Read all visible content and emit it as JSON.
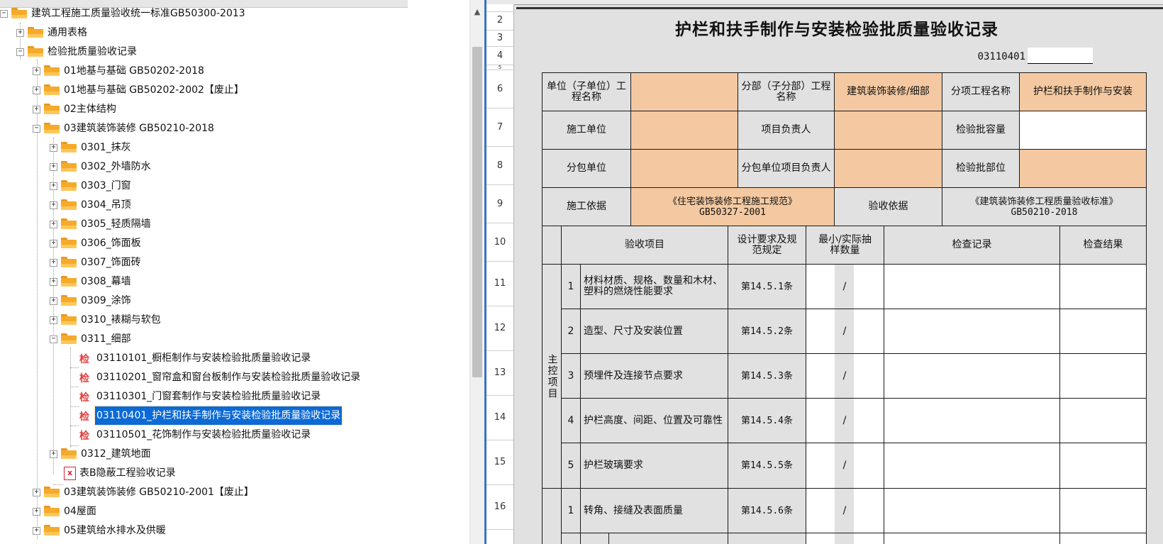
{
  "tree": {
    "root": "建筑工程施工质量验收统一标准GB50300-2013",
    "general": "通用表格",
    "inspection": "检验批质量验收记录",
    "cat01a": "01地基与基础 GB50202-2018",
    "cat01b": "01地基与基础 GB50202-2002【废止】",
    "cat02": "02主体结构",
    "cat03": "03建筑装饰装修 GB50210-2018",
    "sub": [
      "0301_抹灰",
      "0302_外墙防水",
      "0303_门窗",
      "0304_吊顶",
      "0305_轻质隔墙",
      "0306_饰面板",
      "0307_饰面砖",
      "0308_幕墙",
      "0309_涂饰",
      "0310_裱糊与软包",
      "0311_细部"
    ],
    "leaf_icon": "检",
    "leaves": [
      "03110101_橱柜制作与安装检验批质量验收记录",
      "03110201_窗帘盒和窗台板制作与安装检验批质量验收记录",
      "03110301_门窗套制作与安装检验批质量验收记录",
      "03110401_护栏和扶手制作与安装检验批质量验收记录",
      "03110501_花饰制作与安装检验批质量验收记录"
    ],
    "cat0312": "0312_建筑地面",
    "hidden_record": "表B隐蔽工程验收记录",
    "cat03old": "03建筑装饰装修 GB50210-2001【废止】",
    "cat04": "04屋面",
    "cat05": "05建筑给水排水及供暖",
    "expand_plus": "+",
    "expand_minus": "−",
    "scroll_up": "▲"
  },
  "sheet": {
    "rows": [
      "",
      "2",
      "3",
      "4",
      "5",
      "6",
      "7",
      "8",
      "9",
      "10",
      "11",
      "12",
      "13",
      "14",
      "15",
      "16"
    ],
    "title": "护栏和扶手制作与安装检验批质量验收记录",
    "code": "03110401",
    "unit_name_label": "单位（子单位）工程名称",
    "division_label": "分部（子分部）工程名称",
    "division_value": "建筑装饰装修/细部",
    "subitem_label": "分项工程名称",
    "subitem_value": "护栏和扶手制作与安装",
    "constructor_label": "施工单位",
    "pm_label": "项目负责人",
    "capacity_label": "检验批容量",
    "subcontractor_label": "分包单位",
    "sub_pm_label": "分包单位项目负责人",
    "location_label": "检验批部位",
    "basis_label": "施工依据",
    "basis_value": "《住宅装饰装修工程施工规范》GB50327-2001",
    "accept_basis_label": "验收依据",
    "accept_basis_value": "《建筑装饰装修工程质量验收标准》GB50210-2018",
    "h_item": "验收项目",
    "h_design": "设计要求及规范规定",
    "h_sample": "最小/实际抽样数量",
    "h_record": "检查记录",
    "h_result": "检查结果",
    "main_label": "主控项目",
    "items": [
      {
        "no": "1",
        "text": "材料材质、规格、数量和木材、塑料的燃烧性能要求",
        "clause": "第14.5.1条",
        "slash": "/"
      },
      {
        "no": "2",
        "text": "造型、尺寸及安装位置",
        "clause": "第14.5.2条",
        "slash": "/"
      },
      {
        "no": "3",
        "text": "预埋件及连接节点要求",
        "clause": "第14.5.3条",
        "slash": "/"
      },
      {
        "no": "4",
        "text": "护栏高度、间距、位置及可靠性",
        "clause": "第14.5.4条",
        "slash": "/"
      },
      {
        "no": "5",
        "text": "护栏玻璃要求",
        "clause": "第14.5.5条",
        "slash": "/"
      },
      {
        "no": "1",
        "text": "转角、接缝及表面质量",
        "clause": "第14.5.6条",
        "slash": "/"
      }
    ],
    "accent_blue": "#0b6ad6",
    "peach": "#f4c9a1"
  }
}
